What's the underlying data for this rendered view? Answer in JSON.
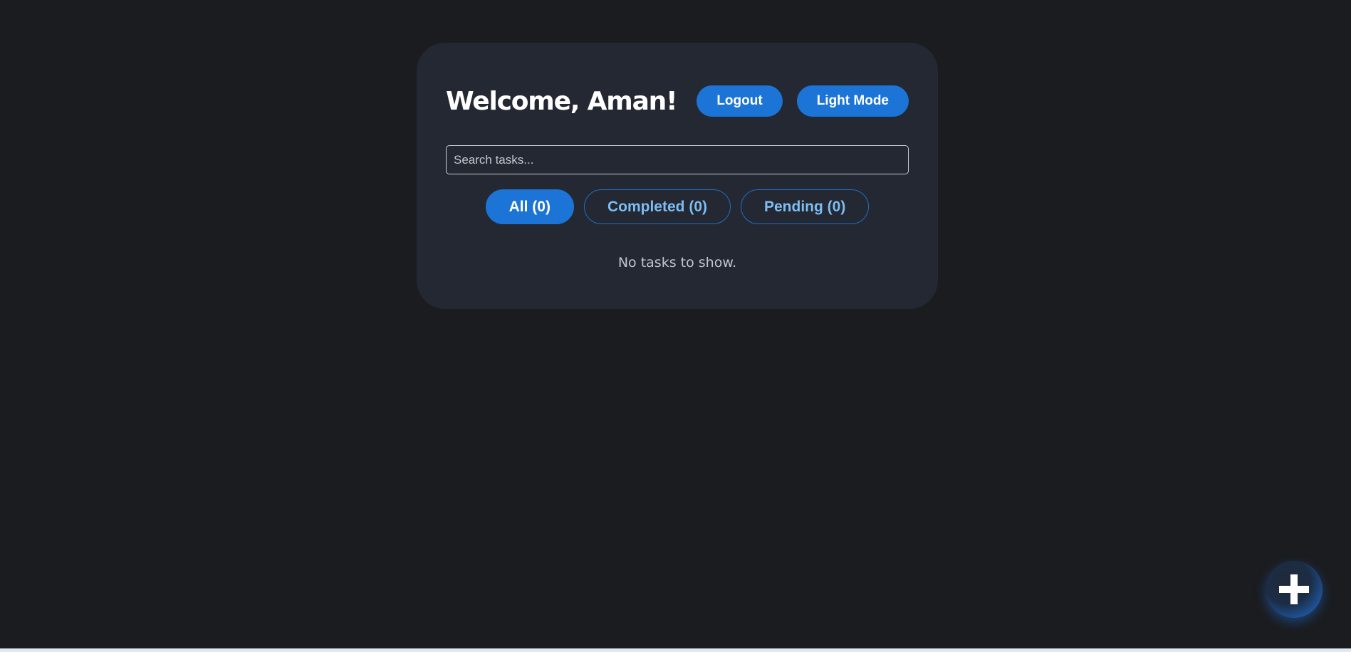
{
  "header": {
    "title": "Welcome, Aman!",
    "logout_label": "Logout",
    "theme_toggle_label": "Light Mode"
  },
  "search": {
    "placeholder": "Search tasks...",
    "value": ""
  },
  "filters": [
    {
      "label": "All (0)",
      "active": true
    },
    {
      "label": "Completed (0)",
      "active": false
    },
    {
      "label": "Pending (0)",
      "active": false
    }
  ],
  "empty_state": "No tasks to show.",
  "fab": {
    "icon": "plus-icon"
  },
  "colors": {
    "background": "#1b1c1f",
    "card": "#242832",
    "accent": "#1b74d6",
    "filter_text": "#7cbdf2"
  }
}
